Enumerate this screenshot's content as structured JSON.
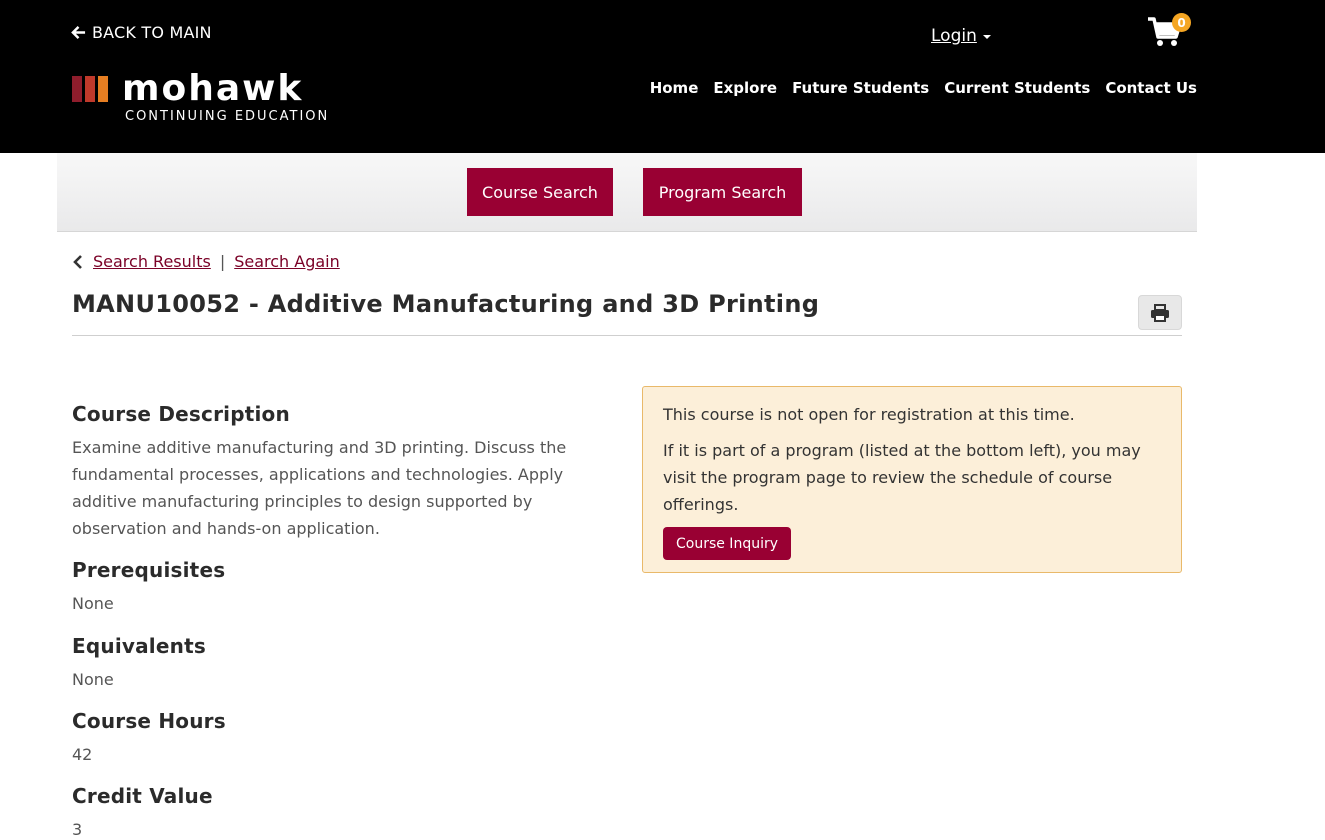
{
  "header": {
    "back_label": "BACK TO MAIN",
    "login_label": "Login",
    "cart_count": "0",
    "logo_word": "mohawk",
    "logo_sub": "CONTINUING EDUCATION",
    "nav": [
      "Home",
      "Explore",
      "Future Students",
      "Current Students",
      "Contact Us"
    ]
  },
  "search": {
    "course_search": "Course Search",
    "program_search": "Program Search"
  },
  "breadcrumb": {
    "results": "Search Results",
    "separator": "|",
    "again": "Search Again"
  },
  "course": {
    "title": "MANU10052 - Additive Manufacturing and 3D Printing",
    "description_heading": "Course Description",
    "description": "Examine additive manufacturing and 3D printing. Discuss the fundamental processes, applications and technologies. Apply additive manufacturing principles to design supported by observation and hands-on application.",
    "prereq_heading": "Prerequisites",
    "prereq": "None",
    "equiv_heading": "Equivalents",
    "equiv": "None",
    "hours_heading": "Course Hours",
    "hours": "42",
    "credit_heading": "Credit Value",
    "credit": "3"
  },
  "notice": {
    "line1": "This course is not open for registration at this time.",
    "line2": "If it is part of a program (listed at the bottom left), you may visit the program page to review the schedule of course offerings.",
    "button": "Course Inquiry"
  },
  "colors": {
    "brand": "#990033",
    "notice_bg": "#fcefd9",
    "badge": "#f5a623"
  },
  "icons": [
    "arrow-left-icon",
    "cart-icon",
    "chevron-left-icon",
    "print-icon",
    "caret-down-icon"
  ]
}
